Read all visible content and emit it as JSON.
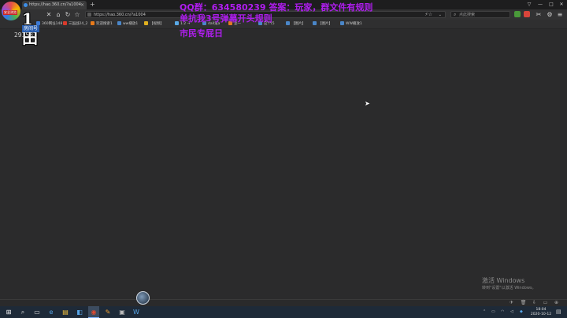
{
  "browser": {
    "tab_title": "https://hao.360.cn/?a1004",
    "url": "https://hao.360.cn/?a1004",
    "search_placeholder": "点此搜索"
  },
  "bookmarks": [
    {
      "label": "360网址148"
    },
    {
      "label": "三国战24_2"
    },
    {
      "label": "欢迎搜索1"
    },
    {
      "label": "ww播放1"
    },
    {
      "label": "【视频】"
    },
    {
      "label": "1.2 →"
    },
    {
      "label": "dall鬼a"
    },
    {
      "label": "歪一"
    },
    {
      "label": "这个(5"
    },
    {
      "label": "【图片】"
    },
    {
      "label": "【图片】"
    },
    {
      "label": "WW播放1"
    }
  ],
  "brand": {
    "logo_badge": "安全浏览",
    "glyph": "1田",
    "sub": "房间号",
    "room_number": "291581"
  },
  "watermark": {
    "line1": "QQ群：634580239 答案：玩家，群文件有规则",
    "line2": "单抗我3号弹幕开头规则",
    "line3": "市民专屁日"
  },
  "activation": {
    "title": "激活 Windows",
    "subtitle": "转到\"设置\"以激活 Windows。"
  },
  "taskbar": {
    "clock_time": "18:04",
    "clock_date": "2020-10-12"
  },
  "icons": {
    "back": "back-arrow-icon",
    "forward": "forward-arrow-icon",
    "home": "home-icon",
    "refresh": "refresh-icon",
    "favorite": "star-icon",
    "search": "search-icon",
    "windows": "windows-icon"
  },
  "colors": {
    "watermark": "#b01df0",
    "page_bg": "#2b2b2c",
    "taskbar_bg": "#1e2a38"
  }
}
